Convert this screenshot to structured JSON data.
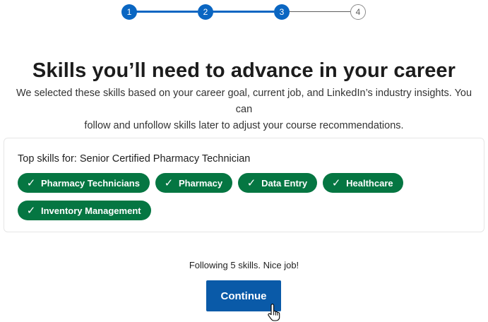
{
  "stepper": {
    "steps": [
      {
        "label": "1",
        "state": "complete"
      },
      {
        "label": "2",
        "state": "complete"
      },
      {
        "label": "3",
        "state": "current"
      },
      {
        "label": "4",
        "state": "upcoming"
      }
    ]
  },
  "header": {
    "title": "Skills you’ll need to advance in your career",
    "subtitle_line1": "We selected these skills based on your career goal, current job, and LinkedIn’s industry insights. You can",
    "subtitle_line2": "follow and unfollow skills later to adjust your course recommendations."
  },
  "skills_card": {
    "title": "Top skills for: Senior Certified Pharmacy Technician",
    "check_glyph": "✓",
    "skills": [
      {
        "label": "Pharmacy Technicians"
      },
      {
        "label": "Pharmacy"
      },
      {
        "label": "Data Entry"
      },
      {
        "label": "Healthcare"
      },
      {
        "label": "Inventory Management"
      }
    ]
  },
  "footer": {
    "following_text": "Following 5 skills. Nice job!",
    "continue_label": "Continue"
  },
  "colors": {
    "accent": "#0a66c2",
    "chip_green": "#057642",
    "button_blue": "#0a5aa8"
  },
  "icons": {
    "chip_icon": "checkmark-icon",
    "cursor": "hand-pointer-cursor"
  }
}
